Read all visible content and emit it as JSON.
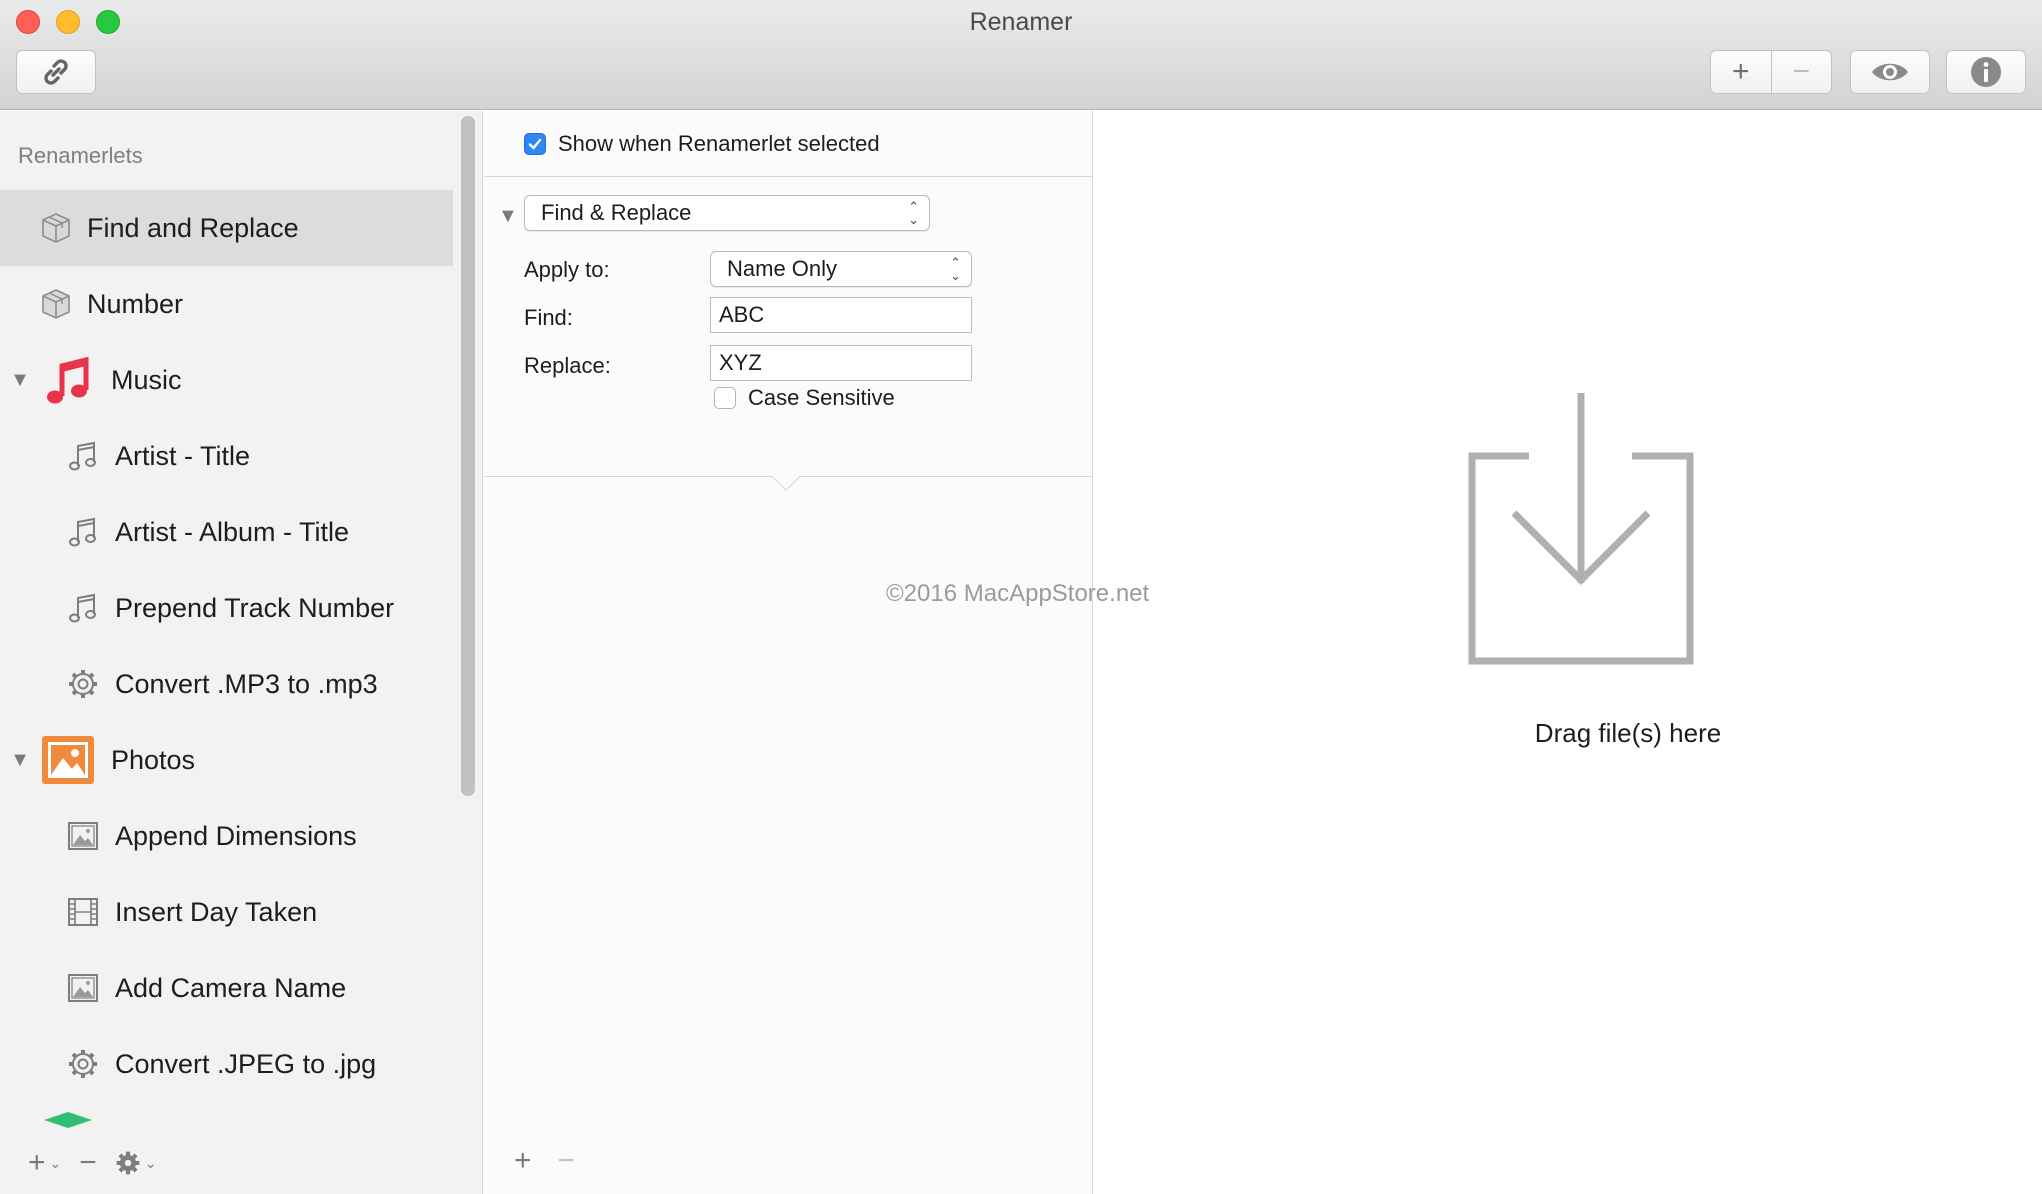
{
  "window": {
    "title": "Renamer"
  },
  "toolbar": {
    "link_icon": "link-icon",
    "add_label": "+",
    "remove_label": "−",
    "preview_icon": "eye-icon",
    "info_icon": "info-icon"
  },
  "sidebar": {
    "header": "Renamerlets",
    "items": [
      {
        "label": "Find and Replace",
        "icon": "box-icon",
        "kind": "top",
        "selected": true
      },
      {
        "label": "Number",
        "icon": "box-icon",
        "kind": "top"
      },
      {
        "label": "Music",
        "icon": "music-app-icon",
        "kind": "group",
        "expanded": true
      },
      {
        "label": "Artist - Title",
        "icon": "music-note-icon",
        "kind": "child"
      },
      {
        "label": "Artist - Album - Title",
        "icon": "music-note-icon",
        "kind": "child"
      },
      {
        "label": "Prepend Track Number",
        "icon": "music-note-icon",
        "kind": "child"
      },
      {
        "label": "Convert .MP3 to .mp3",
        "icon": "gear-icon",
        "kind": "child"
      },
      {
        "label": "Photos",
        "icon": "photos-app-icon",
        "kind": "group",
        "expanded": true
      },
      {
        "label": "Append Dimensions",
        "icon": "image-icon",
        "kind": "child"
      },
      {
        "label": "Insert Day Taken",
        "icon": "film-icon",
        "kind": "child"
      },
      {
        "label": "Add Camera Name",
        "icon": "image-icon",
        "kind": "child"
      },
      {
        "label": "Convert .JPEG to .jpg",
        "icon": "gear-icon",
        "kind": "child"
      }
    ],
    "bottom": {
      "add": "+",
      "remove": "−",
      "settings_icon": "gear-icon"
    }
  },
  "editor": {
    "show_when_selected": {
      "label": "Show when Renamerlet selected",
      "checked": true
    },
    "renamerlet_type": "Find & Replace",
    "apply_to": {
      "label": "Apply to:",
      "value": "Name Only"
    },
    "find": {
      "label": "Find:",
      "value": "ABC"
    },
    "replace": {
      "label": "Replace:",
      "value": "XYZ"
    },
    "case_sensitive": {
      "label": "Case Sensitive",
      "checked": false
    },
    "bottom": {
      "add": "+",
      "remove": "−"
    }
  },
  "drop_zone": {
    "label": "Drag file(s) here",
    "icon": "download-tray-icon"
  },
  "watermark": "©2016 MacAppStore.net"
}
